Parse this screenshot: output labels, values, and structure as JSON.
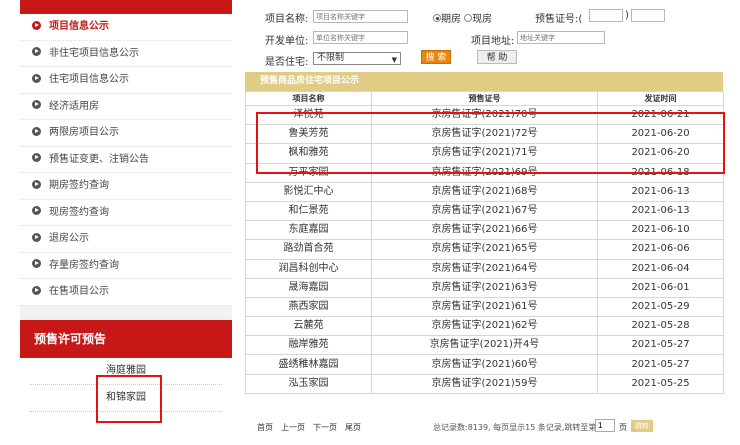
{
  "sidebar": {
    "items": [
      {
        "label": "项目信息公示",
        "active": true
      },
      {
        "label": "非住宅项目信息公示",
        "active": false
      },
      {
        "label": "住宅项目信息公示",
        "active": false
      },
      {
        "label": "经济适用房",
        "active": false
      },
      {
        "label": "两限房项目公示",
        "active": false
      },
      {
        "label": "预售证变更、注销公告",
        "active": false
      },
      {
        "label": "期房签约查询",
        "active": false
      },
      {
        "label": "现房签约查询",
        "active": false
      },
      {
        "label": "退房公示",
        "active": false
      },
      {
        "label": "存量房签约查询",
        "active": false
      },
      {
        "label": "在售项目公示",
        "active": false
      }
    ],
    "section_title": "预售许可预告",
    "sub_items": [
      "海庭雅园",
      "和锦家园"
    ]
  },
  "form": {
    "project_name_label": "项目名称:",
    "project_name_placeholder": "项目名称关键字",
    "radio_futures": "期房",
    "radio_existing": "现房",
    "presale_label": "预售证号:(",
    "presale_close": ")",
    "developer_label": "开发单位:",
    "developer_placeholder": "单位名称关键字",
    "address_label": "项目地址:",
    "address_placeholder": "地址关键字",
    "residential_label": "是否住宅:",
    "residential_value": "不限制",
    "search_button": "搜 索",
    "help_button": "帮 助"
  },
  "table": {
    "title": "预售商品房住宅项目公示",
    "headers": [
      "项目名称",
      "预售证号",
      "发证时间"
    ],
    "rows": [
      [
        "泽悦苑",
        "京房售证字(2021)70号",
        "2021-06-21"
      ],
      [
        "鲁美芳苑",
        "京房售证字(2021)72号",
        "2021-06-20"
      ],
      [
        "枫和雅苑",
        "京房售证字(2021)71号",
        "2021-06-20"
      ],
      [
        "万平家园",
        "京房售证字(2021)69号",
        "2021-06-18"
      ],
      [
        "影悦汇中心",
        "京房售证字(2021)68号",
        "2021-06-13"
      ],
      [
        "和仁景苑",
        "京房售证字(2021)67号",
        "2021-06-13"
      ],
      [
        "东庭嘉园",
        "京房售证字(2021)66号",
        "2021-06-10"
      ],
      [
        "路劲首合苑",
        "京房售证字(2021)65号",
        "2021-06-06"
      ],
      [
        "润昌科创中心",
        "京房售证字(2021)64号",
        "2021-06-04"
      ],
      [
        "晟海嘉园",
        "京房售证字(2021)63号",
        "2021-06-01"
      ],
      [
        "燕西家园",
        "京房售证字(2021)61号",
        "2021-05-29"
      ],
      [
        "云麓苑",
        "京房售证字(2021)62号",
        "2021-05-28"
      ],
      [
        "融岸雅苑",
        "京房售证字(2021)开4号",
        "2021-05-27"
      ],
      [
        "盛绣稚林嘉园",
        "京房售证字(2021)60号",
        "2021-05-27"
      ],
      [
        "泓玉家园",
        "京房售证字(2021)59号",
        "2021-05-25"
      ]
    ]
  },
  "pager": {
    "first": "首页",
    "prev": "上一页",
    "next": "下一页",
    "last": "尾页",
    "info": "总记录数:8139, 每页显示15 条记录,跳转至第",
    "page_value": "1",
    "page_unit": "页",
    "jump": "跳转"
  },
  "colors": {
    "accent": "#c71818",
    "highlight": "#e81010",
    "table_title": "#e1cc86",
    "search_button": "#e8870f"
  }
}
